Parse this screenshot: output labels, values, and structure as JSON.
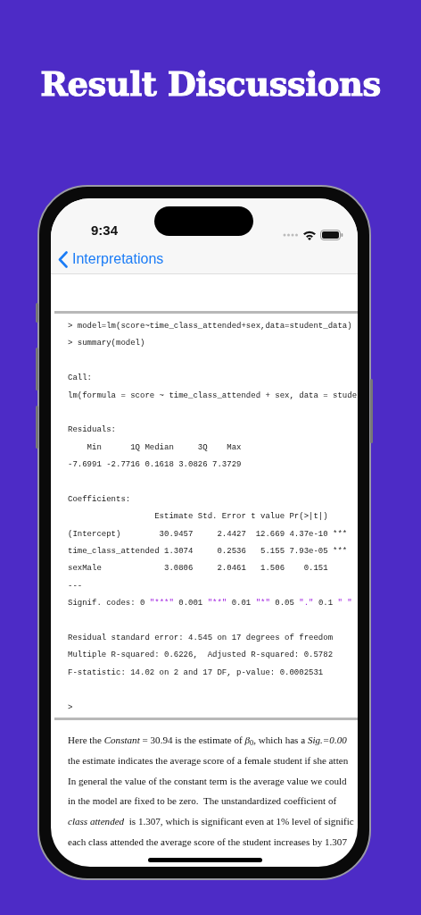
{
  "title": "Result Discussions",
  "status_bar": {
    "time": "9:34"
  },
  "nav": {
    "back_label": "Interpretations"
  },
  "console_blocks": [
    [
      "> model=lm(score~time_class_attended+sex,data=student_data)",
      "> summary(model)"
    ],
    [
      "Call:",
      "lm(formula = score ~ time_class_attended + sex, data = stude"
    ],
    [
      "Residuals:",
      "    Min      1Q Median     3Q    Max",
      "-7.6991 -2.7716 0.1618 3.0826 7.3729"
    ],
    [
      "Coefficients:",
      "                  Estimate Std. Error t value Pr(>|t|)",
      "(Intercept)        30.9457     2.4427  12.669 4.37e-10 ***",
      "time_class_attended 1.3074     0.2536   5.155 7.93e-05 ***",
      "sexMale             3.0806     2.0461   1.506    0.151",
      "---",
      [
        {
          "text": "Signif. codes: 0 ",
          "quoted": false
        },
        {
          "text": "\"***\"",
          "quoted": true
        },
        {
          "text": " 0.001 ",
          "quoted": false
        },
        {
          "text": "\"**\"",
          "quoted": true
        },
        {
          "text": " 0.01 ",
          "quoted": false
        },
        {
          "text": "\"*\"",
          "quoted": true
        },
        {
          "text": " 0.05 ",
          "quoted": false
        },
        {
          "text": "\".\"",
          "quoted": true
        },
        {
          "text": " 0.1 ",
          "quoted": false
        },
        {
          "text": "\" \"",
          "quoted": true
        }
      ]
    ],
    [
      "Residual standard error: 4.545 on 17 degrees of freedom",
      "Multiple R-squared: 0.6226,  Adjusted R-squared: 0.5782",
      "F-statistic: 14.02 on 2 and 17 DF, p-value: 0.0002531"
    ],
    [
      ">"
    ]
  ],
  "paragraph_lines": [
    "Here the *Constant* = 30.94 is the estimate of *β*$_{0}$, which has a *Sig.=0.00*",
    "the estimate indicates the average score of a female student if she atten",
    "In general the value of the constant term is the average value we could",
    "in the model are fixed to be zero.  The unstandardized coefficient of",
    "*class attended*  is 1.307, which is significant even at 1% level of signific",
    "each class attended the average score of the student increases by 1.307"
  ]
}
